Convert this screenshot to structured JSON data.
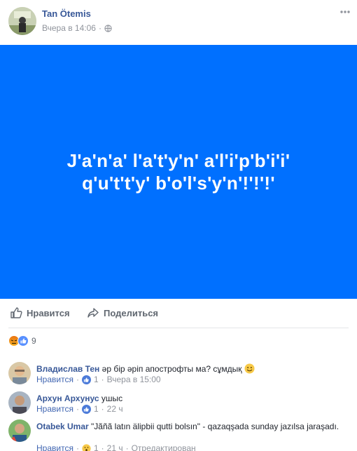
{
  "post": {
    "author": "Tan Ötemis",
    "time": "Вчера в 14:06",
    "separator": "·",
    "image_lines": [
      "J'a'n'a' l'a't'y'n' a'l'i'p'b'i'i'",
      "q'u't't'y' b'o'l's'y'n'!'!'!'"
    ],
    "image_color": "#0070ff"
  },
  "actions": {
    "like_label": "Нравится",
    "share_label": "Поделиться"
  },
  "reactions": {
    "count": "9"
  },
  "comments": [
    {
      "name": "Владислав Тен",
      "text": "әр бір әріп апострофты ма? сұмдық",
      "like_label": "Нравится",
      "likes": "1",
      "time": "Вчера в 15:00"
    },
    {
      "name": "Архун Архунус",
      "text": "ушыс",
      "like_label": "Нравится",
      "likes": "1",
      "time": "22 ч"
    },
    {
      "name": "Otabek Umar",
      "text": "\"Jãñã latın älipbii qutti bolsın\" - qazaqşada sunday jazılsa jaraşadı.",
      "like_label": "Нравится",
      "likes": "1",
      "time": "21 ч",
      "edited": "Отредактирован"
    }
  ]
}
